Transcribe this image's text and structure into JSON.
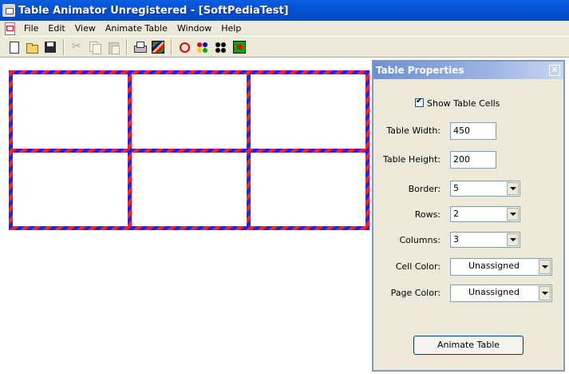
{
  "window": {
    "title": "Table Animator Unregistered - [SoftPediaTest]"
  },
  "menu": [
    "File",
    "Edit",
    "View",
    "Animate Table",
    "Window",
    "Help"
  ],
  "toolbar": {
    "icons": [
      "new-icon",
      "open-icon",
      "save-icon",
      "cut-icon",
      "copy-icon",
      "paste-icon",
      "print-icon",
      "stripes-icon",
      "ring-icon",
      "color-dots-icon",
      "black-dots-icon",
      "color-grid-icon"
    ]
  },
  "table": {
    "rows": 2,
    "columns": 3,
    "border_colors": [
      "#ff2020",
      "#2020ff"
    ]
  },
  "panel": {
    "title": "Table Properties",
    "close": "✕",
    "show_cells_label": "Show Table Cells",
    "show_cells_checked": true,
    "width_label": "Table Width:",
    "width_value": "450",
    "height_label": "Table Height:",
    "height_value": "200",
    "border_label": "Border:",
    "border_value": "5",
    "rows_label": "Rows:",
    "rows_value": "2",
    "columns_label": "Columns:",
    "columns_value": "3",
    "cell_color_label": "Cell Color:",
    "cell_color_value": "Unassigned",
    "page_color_label": "Page Color:",
    "page_color_value": "Unassigned",
    "animate_button": "Animate Table"
  }
}
